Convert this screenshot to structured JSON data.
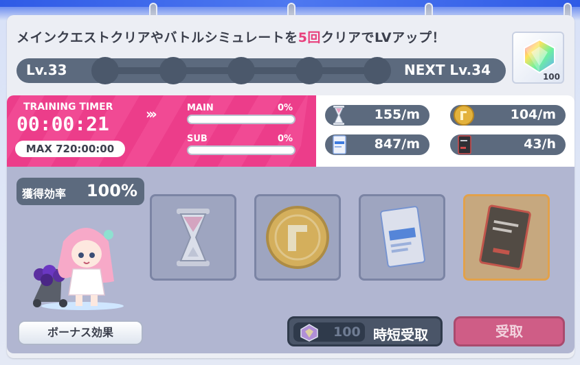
{
  "header": {
    "mission_prefix": "メインクエストクリアやバトルシミュレートを",
    "mission_count": "5回",
    "mission_suffix": "クリアでLVアップ！",
    "reward_count": "100"
  },
  "level": {
    "current": "Lv.33",
    "next": "NEXT Lv.34",
    "progress_nodes_filled": 0,
    "progress_nodes_total": 5
  },
  "timer": {
    "label": "TRAINING TIMER",
    "value": "00:00:21",
    "max": "MAX 720:00:00",
    "main_label": "MAIN",
    "main_pct": "0%",
    "main_fraction": 0,
    "sub_label": "SUB",
    "sub_pct": "0%",
    "sub_fraction": 0
  },
  "rates": {
    "hourglass": "155/m",
    "coin": "104/m",
    "training_report": "847/m",
    "technical_report": "43/h"
  },
  "efficiency": {
    "label": "獲得効率",
    "value": "100%"
  },
  "buttons": {
    "bonus": "ボーナス効果",
    "shorten_cost": "100",
    "shorten": "時短受取",
    "receive": "受取"
  },
  "colors": {
    "accent_pink": "#ec3d8a",
    "slate": "#5c6a7e"
  }
}
